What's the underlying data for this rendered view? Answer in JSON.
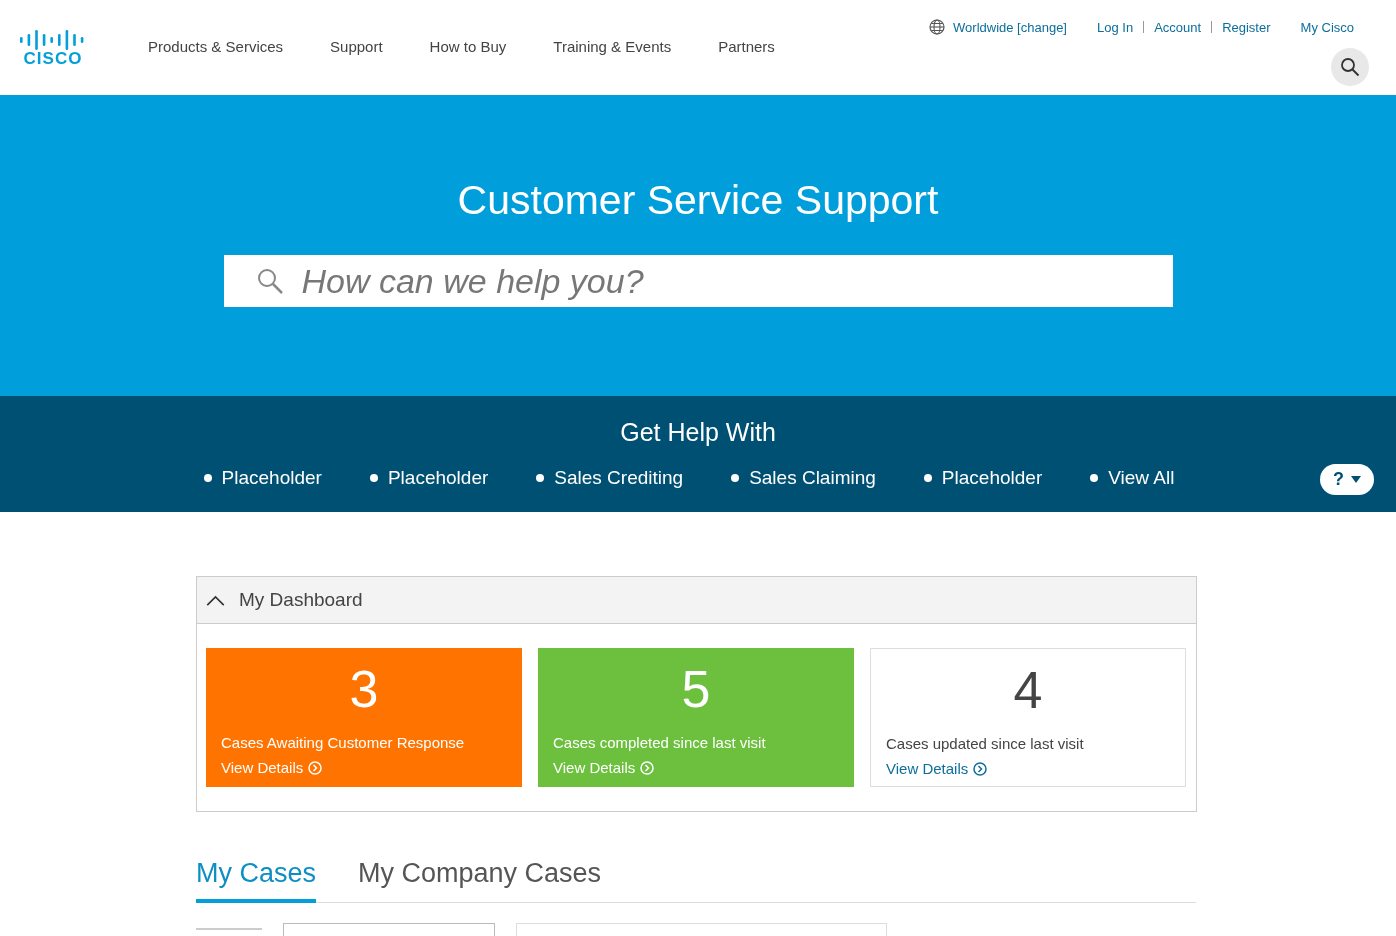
{
  "header": {
    "logo_text": "CISCO",
    "nav": [
      {
        "label": "Products & Services"
      },
      {
        "label": "Support"
      },
      {
        "label": "How to Buy"
      },
      {
        "label": "Training & Events"
      },
      {
        "label": "Partners"
      }
    ],
    "region": "Worldwide [change]",
    "account_links": [
      "Log In",
      "Account",
      "Register"
    ],
    "my_link": "My Cisco"
  },
  "hero": {
    "title": "Customer Service Support",
    "search": {
      "placeholder": "How can we help you?"
    }
  },
  "help_bar": {
    "title": "Get Help With",
    "items": [
      "Placeholder",
      "Placeholder",
      "Sales Crediting",
      "Sales Claiming",
      "Placeholder",
      "View All"
    ],
    "help_button": "?"
  },
  "dashboard": {
    "title": "My Dashboard",
    "expanded": true,
    "cards": [
      {
        "kind": "filled",
        "color": "#ff7300",
        "count": "3",
        "label": "Cases Awaiting Customer Response",
        "link": "View Details"
      },
      {
        "kind": "filled",
        "color": "#6cc03e",
        "count": "5",
        "label": "Cases completed since last visit",
        "link": "View Details"
      },
      {
        "kind": "outline",
        "count": "4",
        "label": "Cases updated since last visit",
        "link": "View Details"
      }
    ]
  },
  "tabs": [
    {
      "label": "My Cases",
      "selected": true
    },
    {
      "label": "My Company Cases",
      "selected": false
    }
  ]
}
